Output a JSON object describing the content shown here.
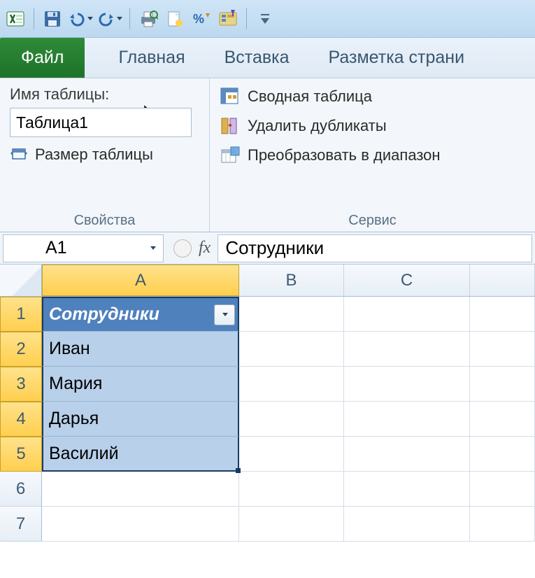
{
  "qat": {
    "dropdown": "▾"
  },
  "tabs": {
    "file": "Файл",
    "home": "Главная",
    "insert": "Вставка",
    "page_layout": "Разметка страни"
  },
  "ribbon": {
    "properties": {
      "label": "Имя таблицы:",
      "value": "Таблица1",
      "resize": "Размер таблицы",
      "group": "Свойства"
    },
    "tools": {
      "pivot": "Сводная таблица",
      "remove_dupes": "Удалить дубликаты",
      "convert_range": "Преобразовать в диапазон",
      "group": "Сервис"
    }
  },
  "formula_bar": {
    "name_box": "A1",
    "fx": "fx",
    "formula_value": "Сотрудники"
  },
  "columns": [
    "A",
    "B",
    "C"
  ],
  "rows": [
    "1",
    "2",
    "3",
    "4",
    "5",
    "6",
    "7"
  ],
  "table": {
    "header": "Сотрудники",
    "data": [
      "Иван",
      "Мария",
      "Дарья",
      "Василий"
    ]
  }
}
